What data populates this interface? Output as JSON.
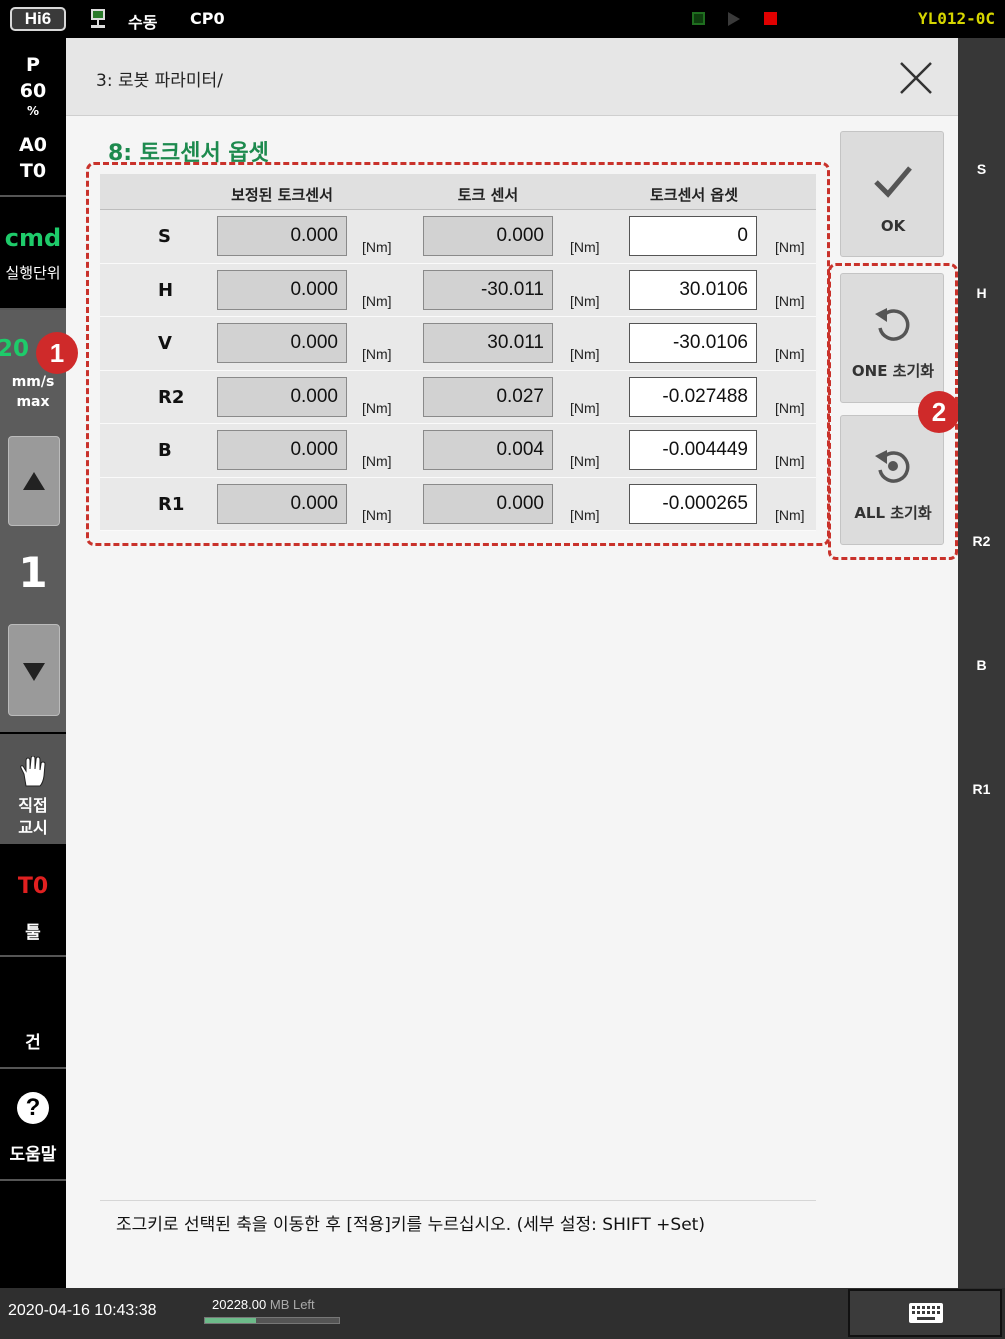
{
  "topbar": {
    "logo": "Hi6",
    "mode": "수동",
    "program": "CP0",
    "robot_id": "YL012-0C"
  },
  "left": {
    "speed_p": "P",
    "speed_pct": "60",
    "pct_unit": "%",
    "a0": "A0",
    "t0": "T0",
    "cmd": "cmd",
    "exec_unit": "실행단위",
    "speed_val": "20",
    "speed_unit": "mm/s",
    "speed_max": "max",
    "step_num": "1",
    "direct_teach_1": "직접",
    "direct_teach_2": "교시",
    "tool_code": "T0",
    "tool_label": "툴",
    "gun_label": "건",
    "help_label": "도움말"
  },
  "header": {
    "breadcrumb": "3: 로봇 파라미터/"
  },
  "page_title": "8: 토크센서 옵셋",
  "table": {
    "headers": [
      "보정된 토크센서",
      "토크 센서",
      "토크센서 옵셋"
    ],
    "unit": "[Nm]",
    "rows": [
      {
        "axis": "S",
        "corrected": "0.000",
        "sensor": "0.000",
        "offset": "0"
      },
      {
        "axis": "H",
        "corrected": "0.000",
        "sensor": "-30.011",
        "offset": "30.0106"
      },
      {
        "axis": "V",
        "corrected": "0.000",
        "sensor": "30.011",
        "offset": "-30.0106"
      },
      {
        "axis": "R2",
        "corrected": "0.000",
        "sensor": "0.027",
        "offset": "-0.027488"
      },
      {
        "axis": "B",
        "corrected": "0.000",
        "sensor": "0.004",
        "offset": "-0.004449"
      },
      {
        "axis": "R1",
        "corrected": "0.000",
        "sensor": "0.000",
        "offset": "-0.000265"
      }
    ]
  },
  "buttons": {
    "ok": "OK",
    "one_init": "ONE 초기화",
    "all_init": "ALL 초기화"
  },
  "markers": {
    "m1": "1",
    "m2": "2"
  },
  "axes": [
    "S",
    "H",
    "R2",
    "B",
    "R1"
  ],
  "hint": "조그키로 선택된 축을 이동한 후 [적용]키를 누르십시오. (세부 설정: SHIFT +Set)",
  "bottom": {
    "datetime": "2020-04-16 10:43:38",
    "memory": "20228.00",
    "memory_unit": "MB Left",
    "memory_fill": 0.38
  },
  "colors": {
    "title_green": "#1d8a4e",
    "cmd_green": "#1ecb6a",
    "marker_red": "#cf2a2a",
    "tool_red": "#e02020",
    "robot_id_yellow": "#d6d600"
  },
  "icons": [
    "monitor-icon",
    "close-icon",
    "checkmark-icon",
    "reset-one-icon",
    "reset-all-icon",
    "hand-icon",
    "help-icon",
    "keyboard-icon"
  ]
}
